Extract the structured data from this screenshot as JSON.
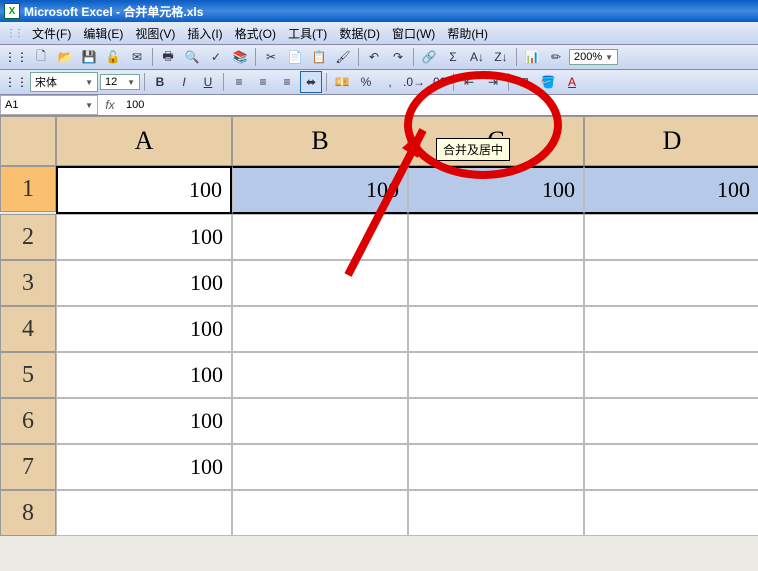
{
  "title": "Microsoft Excel - 合并单元格.xls",
  "menu": {
    "file": "文件(F)",
    "edit": "编辑(E)",
    "view": "视图(V)",
    "insert": "插入(I)",
    "format": "格式(O)",
    "tools": "工具(T)",
    "data": "数据(D)",
    "window": "窗口(W)",
    "help": "帮助(H)"
  },
  "zoom": "200%",
  "font_name": "宋体",
  "font_size": "12",
  "tooltip": "合并及居中",
  "name_box": "A1",
  "formula_value": "100",
  "columns": [
    "A",
    "B",
    "C",
    "D"
  ],
  "rows": [
    "1",
    "2",
    "3",
    "4",
    "5",
    "6",
    "7",
    "8"
  ],
  "grid": {
    "r1": {
      "A": "100",
      "B": "100",
      "C": "100",
      "D": "100"
    },
    "r2": {
      "A": "100",
      "B": "",
      "C": "",
      "D": ""
    },
    "r3": {
      "A": "100",
      "B": "",
      "C": "",
      "D": ""
    },
    "r4": {
      "A": "100",
      "B": "",
      "C": "",
      "D": ""
    },
    "r5": {
      "A": "100",
      "B": "",
      "C": "",
      "D": ""
    },
    "r6": {
      "A": "100",
      "B": "",
      "C": "",
      "D": ""
    },
    "r7": {
      "A": "100",
      "B": "",
      "C": "",
      "D": ""
    },
    "r8": {
      "A": "",
      "B": "",
      "C": "",
      "D": ""
    }
  },
  "chart_data": {
    "type": "table",
    "title": "合并单元格.xls",
    "columns": [
      "A",
      "B",
      "C",
      "D"
    ],
    "rows": [
      [
        100,
        100,
        100,
        100
      ],
      [
        100,
        null,
        null,
        null
      ],
      [
        100,
        null,
        null,
        null
      ],
      [
        100,
        null,
        null,
        null
      ],
      [
        100,
        null,
        null,
        null
      ],
      [
        100,
        null,
        null,
        null
      ],
      [
        100,
        null,
        null,
        null
      ],
      [
        null,
        null,
        null,
        null
      ]
    ]
  }
}
